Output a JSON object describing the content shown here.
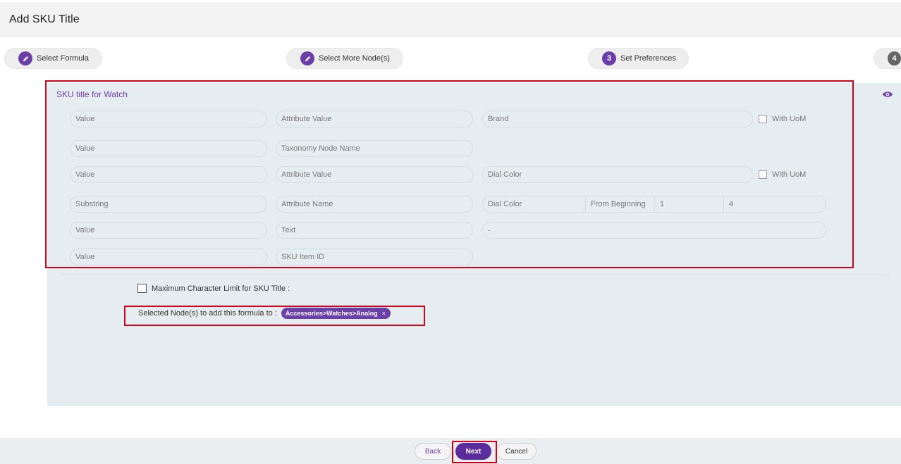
{
  "header": {
    "title": "Add SKU Title"
  },
  "stepper": [
    {
      "label": "Select Formula",
      "icon": "pencil-icon",
      "marker": ""
    },
    {
      "label": "Select More Node(s)",
      "icon": "pencil-icon",
      "marker": ""
    },
    {
      "label": "Set Preferences",
      "icon": "number",
      "marker": "3"
    },
    {
      "label": "",
      "icon": "number",
      "marker": "4"
    }
  ],
  "section": {
    "title": "SKU title for Watch",
    "rows": [
      {
        "type": "Value",
        "source": "Attribute Value",
        "field": "Brand",
        "checkbox_label": "With UoM"
      },
      {
        "type": "Value",
        "source": "Taxonomy Node Name"
      },
      {
        "type": "Value",
        "source": "Attribute Value",
        "field": "Dial Color",
        "checkbox_label": "With UoM"
      },
      {
        "type": "Substring",
        "source": "Attribute Name",
        "field": "Dial Color",
        "position": "From Beginning",
        "start": "1",
        "length": "4"
      },
      {
        "type": "Value",
        "source": "Text",
        "field": "-"
      },
      {
        "type": "Value",
        "source": "SKU Item ID"
      }
    ]
  },
  "max_limit": {
    "label": "Maximum Character Limit for SKU Title :"
  },
  "selected_nodes": {
    "label": "Selected Node(s) to add this formula to :",
    "chip": "Accessories>Watches>Analog",
    "remove": "×"
  },
  "footer": {
    "back": "Back",
    "next": "Next",
    "cancel": "Cancel"
  },
  "colors": {
    "accent": "#6b3fa8",
    "panel": "#e6edf0",
    "highlight": "#d0021b"
  }
}
